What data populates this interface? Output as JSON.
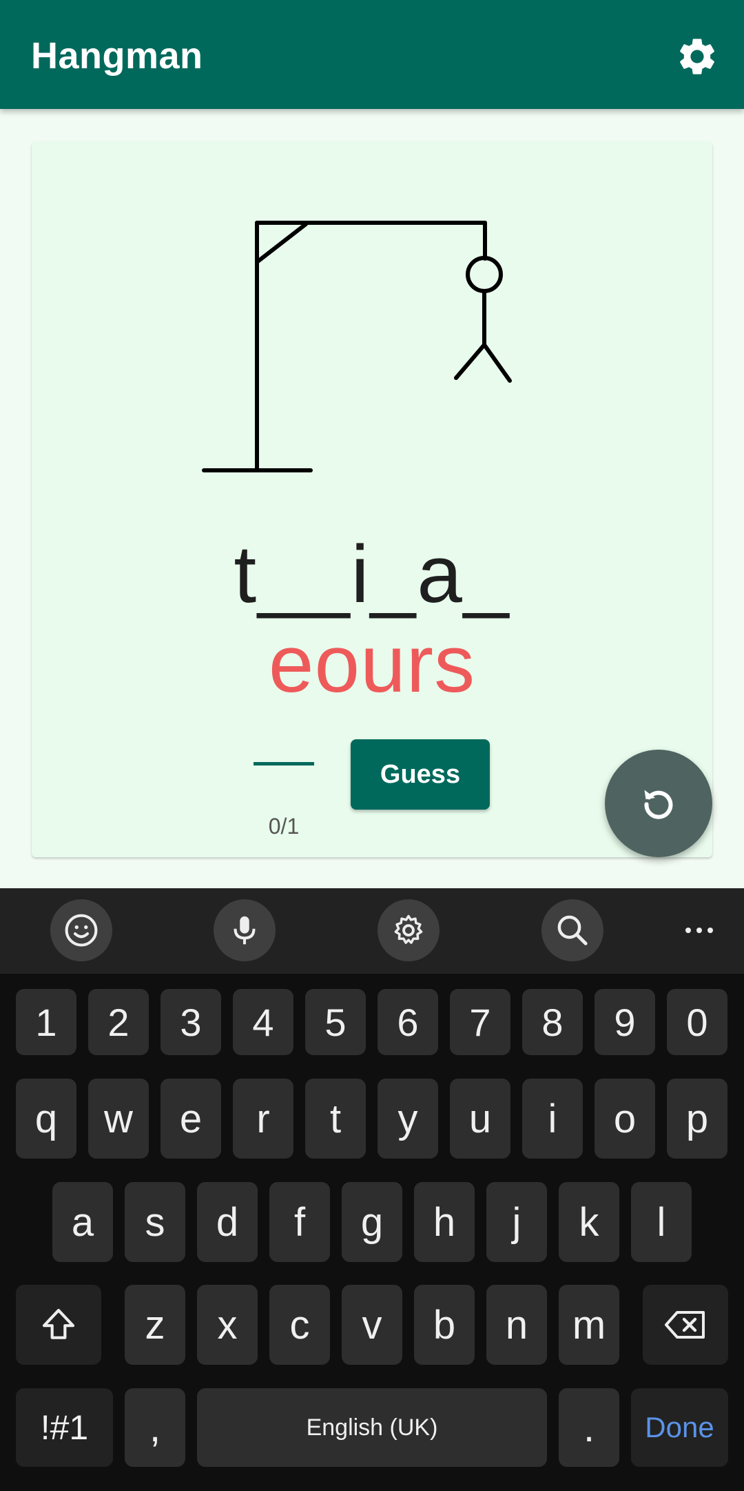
{
  "app": {
    "title": "Hangman",
    "accent_color": "#00695c",
    "icons": {
      "settings": "gear-icon",
      "restart": "restart-icon"
    }
  },
  "game": {
    "masked_word": "t__i_a_",
    "wrong_letters": "eours",
    "wrong_letters_color": "#ee5a5a",
    "guess_input_value": "",
    "guess_counter": "0/1",
    "guess_button_label": "Guess"
  },
  "keyboard": {
    "toolbar_icons": [
      "emoji-icon",
      "microphone-icon",
      "gear-icon",
      "search-icon",
      "more-icon"
    ],
    "number_row": [
      "1",
      "2",
      "3",
      "4",
      "5",
      "6",
      "7",
      "8",
      "9",
      "0"
    ],
    "row1": [
      "q",
      "w",
      "e",
      "r",
      "t",
      "y",
      "u",
      "i",
      "o",
      "p"
    ],
    "row2": [
      "a",
      "s",
      "d",
      "f",
      "g",
      "h",
      "j",
      "k",
      "l"
    ],
    "row3": [
      "z",
      "x",
      "c",
      "v",
      "b",
      "n",
      "m"
    ],
    "symbols_label": "!#1",
    "comma_label": ",",
    "space_label": "English (UK)",
    "period_label": ".",
    "done_label": "Done"
  }
}
